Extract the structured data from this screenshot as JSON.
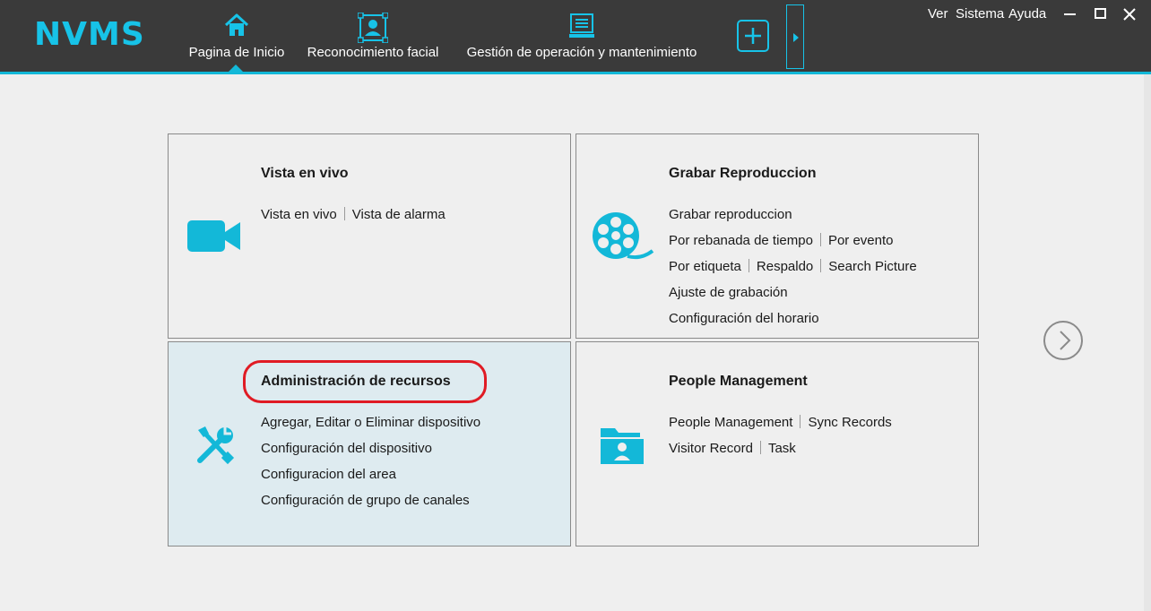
{
  "app": {
    "logo": "NVMS",
    "accent_color": "#17c3e8",
    "topbar_color": "#3a3a3a"
  },
  "nav": {
    "items": [
      {
        "label": "Pagina de Inicio",
        "icon": "home-icon",
        "active": true
      },
      {
        "label": "Reconocimiento facial",
        "icon": "face-recognition-icon",
        "active": false
      },
      {
        "label": "Gestión de operación y mantenimiento",
        "icon": "monitor-icon",
        "active": false
      }
    ],
    "add_icon": "plus-icon",
    "expand_icon": "triangle-right-icon"
  },
  "top_menu": {
    "ver": "Ver",
    "sistema": "Sistema",
    "ayuda": "Ayuda"
  },
  "window_controls": [
    "minimize-icon",
    "maximize-icon",
    "close-icon"
  ],
  "cards": {
    "live": {
      "title": "Vista en vivo",
      "icon": "video-camera-icon",
      "rows": [
        [
          "Vista en vivo",
          "Vista de alarma"
        ]
      ]
    },
    "playback": {
      "title": "Grabar Reproduccion",
      "icon": "film-reel-icon",
      "rows": [
        [
          "Grabar reproduccion"
        ],
        [
          "Por rebanada de tiempo",
          "Por evento"
        ],
        [
          "Por etiqueta",
          "Respaldo",
          "Search Picture"
        ],
        [
          "Ajuste de grabación"
        ],
        [
          "Configuración del horario"
        ]
      ]
    },
    "resources": {
      "title": "Administración de recursos",
      "icon": "tools-icon",
      "selected": true,
      "highlight_color": "#e01b24",
      "rows": [
        [
          "Agregar, Editar o Eliminar dispositivo"
        ],
        [
          "Configuración del dispositivo"
        ],
        [
          "Configuracion del area"
        ],
        [
          "Configuración de grupo de canales"
        ]
      ]
    },
    "people": {
      "title": "People Management",
      "icon": "person-folder-icon",
      "rows": [
        [
          "People Management",
          "Sync Records"
        ],
        [
          "Visitor Record",
          "Task"
        ]
      ]
    }
  },
  "pager": {
    "next_icon": "chevron-right-icon"
  }
}
